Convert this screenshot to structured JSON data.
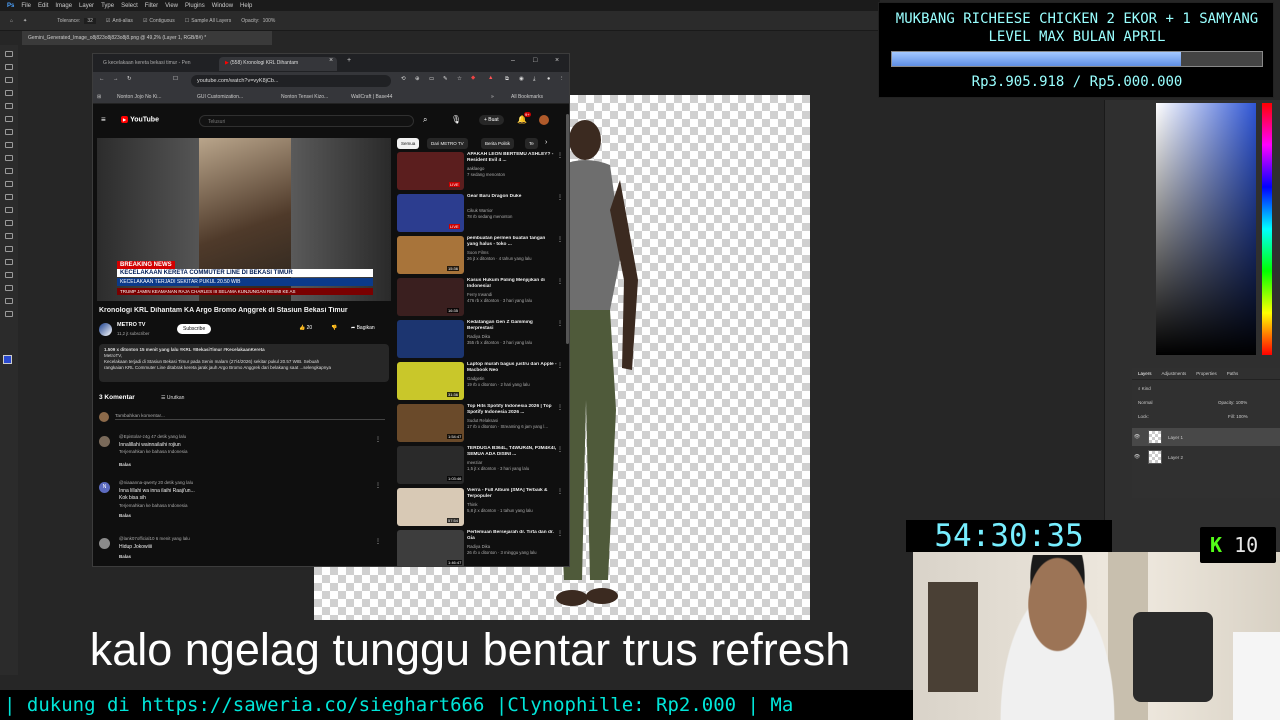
{
  "photoshop": {
    "menu": [
      "File",
      "Edit",
      "Image",
      "Layer",
      "Type",
      "Select",
      "Filter",
      "View",
      "Plugins",
      "Window",
      "Help"
    ],
    "options": {
      "tolerance_label": "Tolerance:",
      "tolerance_value": "32",
      "antialias": "Anti-alias",
      "contiguous": "Contiguous",
      "sample_all": "Sample All Layers",
      "opacity_label": "Opacity:",
      "opacity_value": "100%"
    },
    "document_tab": "Gemini_Generated_Image_o8j823o8j823o8j8.png @ 49,2% (Layer 1, RGB/8#) *",
    "layers": {
      "tabs": [
        "Layers",
        "Adjustments",
        "Properties",
        "Paths"
      ],
      "kind": "Kind",
      "blend_mode": "Normal",
      "opacity_label": "Opacity:",
      "opacity_value": "100%",
      "lock_label": "Lock:",
      "fill_label": "Fill:",
      "fill_value": "100%",
      "items": [
        "Layer 1",
        "Layer 2"
      ]
    }
  },
  "browser": {
    "tabs": [
      {
        "title": "kecelakaan kereta bekasi timur - Pen"
      },
      {
        "title": "(558) Kronologi KRL Dihantam"
      }
    ],
    "url": "youtube.com/watch?v=vyK8jCb...",
    "bookmarks": [
      "Nonton Jojo No Ki...",
      "GUI Customization...",
      "Nonton Tensei Kizo...",
      "WallCraft | Base44",
      "All Bookmarks"
    ],
    "window_controls": [
      "–",
      "□",
      "×"
    ]
  },
  "youtube": {
    "logo": "YouTube",
    "search_placeholder": "Telusuri",
    "create_label": "+ Buat",
    "notif_count": "9+",
    "video": {
      "breaking": "BREAKING NEWS",
      "ticker_main": "KECELAKAAN KERETA COMMUTER LINE DI BEKASI TIMUR",
      "ticker_sub": "KECELAKAAN TERJADI SEKITAR PUKUL 20.50 WIB",
      "ticker_bottom": "TRUMP JAMIN KEAMANAN RAJA CHARLES III SELAMA KUNJUNGAN RESMI KE AS",
      "title": "Kronologi KRL Dihantam KA Argo Bromo Anggrek di Stasiun Bekasi Timur"
    },
    "channel": {
      "name": "METRO TV",
      "subscribers": "11,2 jt subscriber",
      "subscribe": "Subscribe",
      "likes": "20",
      "share": "Bagikan"
    },
    "description": {
      "meta": "1.509 x ditonton  15 menit yang lalu  #KRL #BekasiTimur #KecelakaanKereta",
      "line1": "MetroTV,",
      "line2": "Kecelakaan terjadi di Stasiun Bekasi Timur pada Senin malam (27/4/2026) sekitar pukul 20.57 WIB. Sebuah",
      "line3": "rangkaian KRL Commuter Line ditabrak kereta jarak jauh Argo Bromo Anggrek dari belakang saat ...selengkapnya"
    },
    "comments_header": {
      "count": "3 Komentar",
      "sort": "Urutkan"
    },
    "add_comment": "Tambahkan komentar...",
    "comments": [
      {
        "handle": "@Epistolar-z4g  47 detik yang lalu",
        "text": "Innalillahi wainnailaihi rojiun",
        "translate": "Terjemahkan ke bahasa Indonesia",
        "reply": "Balas",
        "avatar_color": "#7a6a5a"
      },
      {
        "handle": "@niaaanna-qwerty  20 detik yang lalu",
        "text": "Inna lillahi wa inna ilaihi Raaji'un...",
        "text2": "Kok bisa sih",
        "translate": "Terjemahkan ke bahasa Indonesia",
        "reply": "Balas",
        "avatar_color": "#5c6bc0",
        "initial": "N"
      },
      {
        "handle": "@lank07official10  6 menit yang lalu",
        "text": "Hidup Jokowiiii",
        "reply": "Balas",
        "avatar_color": "#8a8a8a"
      }
    ],
    "chips": [
      "Semua",
      "Dari METRO TV",
      "Berita Politik",
      "Te"
    ],
    "recommendations": [
      {
        "title": "APAKAH LEON BERTEMU ASHLEY? - Resident Evil 4 ...",
        "channel": "aaklaego",
        "meta": "7 sedang menonton",
        "badge": "LIVE",
        "color": "#5b1e1e"
      },
      {
        "title": "Gear Baru Dragon Duke",
        "channel": "Cikuk Warrior",
        "meta": "78 rb sedang menonton",
        "badge": "LIVE",
        "color": "#2c3d8f"
      },
      {
        "title": "pembuatan permen buatan tangan yang halus - toko ...",
        "channel": "Soon Films",
        "meta": "26 jt x ditonton · 4 tahun yang lalu",
        "badge": "15:36",
        "color": "#a8743a"
      },
      {
        "title": "Kasus Hukum Paling Menjijikan di Indonesia!",
        "channel": "Ferry Irwandi",
        "meta": "476 rb x ditonton · 3 hari yang lalu",
        "badge": "16:35",
        "color": "#3a1f1f"
      },
      {
        "title": "Kedatangan Gen Z Gamming Berprestasi",
        "channel": "Radiya Dika",
        "meta": "355 rb x ditonton · 3 hari yang lalu",
        "badge": "",
        "color": "#1c3570"
      },
      {
        "title": "Laptop murah bagus justru dari Apple - Macbook Neo",
        "channel": "Gadgetin",
        "meta": "19 rb x ditonton · 2 hari yang lalu",
        "badge": "31:36",
        "color": "#c9c72a"
      },
      {
        "title": "Top Hits Spotify Indonesia 2026 | Top Spotify Indonesia 2026 ...",
        "channel": "Sudut Relaksasi",
        "meta": "17 rb x ditonton · Streaming 6 jam yang l...",
        "badge": "1:54:47",
        "color": "#6a4a2a"
      },
      {
        "title": "TERDUGA B364L, T4WUR4N, P3M4K4I, SEMUA ADA DISINI ...",
        "channel": "meeziar",
        "meta": "1,5 jt x ditonton · 3 hari yang lalu",
        "badge": "1:03:46",
        "color": "#2a2a2a"
      },
      {
        "title": "Vierra - Full Album [SMA] Terbaik & Terpopuler",
        "channel": "Think",
        "meta": "5,8 jt x ditonton · 1 tahun yang lalu",
        "badge": "57:54",
        "color": "#d8c9b5"
      },
      {
        "title": "Pertemuan Bersejarah dr. Tirta dan dr. Gia",
        "channel": "Radiya Dika",
        "meta": "26 rb x ditonton · 3 minggu yang lalu",
        "badge": "1:46:47",
        "color": "#3d3d3d"
      }
    ]
  },
  "overlay": {
    "goal_title": "MUKBANG RICHEESE CHICKEN 2 EKOR + 1 SAMYANG LEVEL MAX BULAN APRIL",
    "goal_amount": "Rp3.905.918 / Rp5.000.000",
    "goal_progress": 0.78,
    "timer": "54:30:35",
    "kick_viewers": "10",
    "subtitle": "kalo ngelag tunggu bentar trus refresh",
    "marquee": "| dukung di https://saweria.co/sieghart666 |Clynophille: Rp2.000 | Ma"
  }
}
